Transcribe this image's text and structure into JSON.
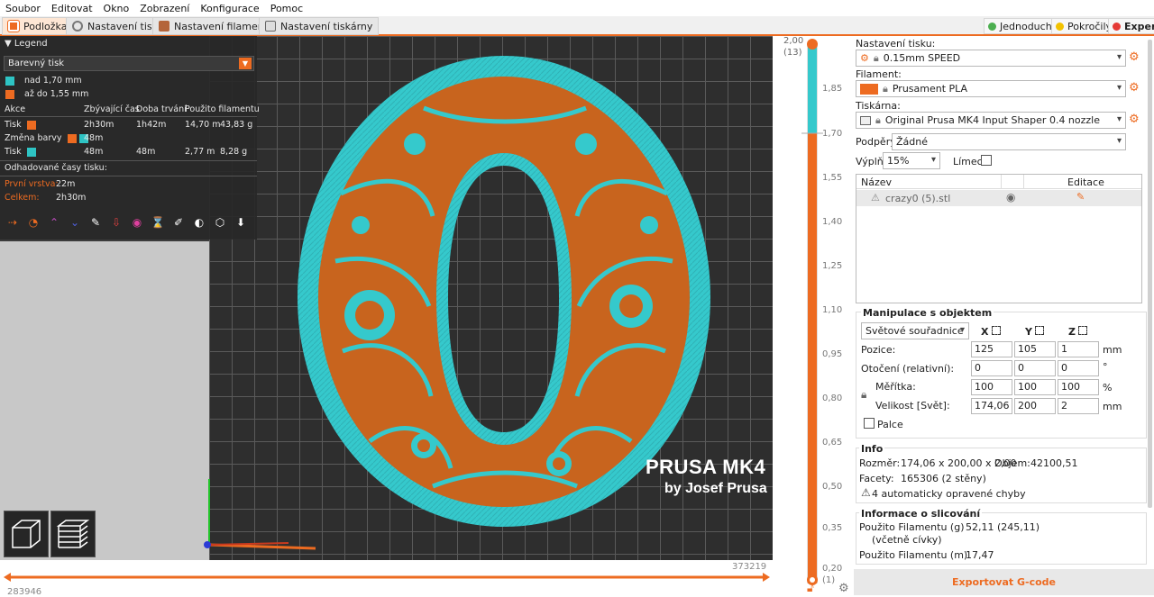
{
  "menu": [
    "Soubor",
    "Editovat",
    "Okno",
    "Zobrazení",
    "Konfigurace",
    "Pomoc"
  ],
  "tabs": [
    {
      "label": "Podložka",
      "icon": "plate-icon"
    },
    {
      "label": "Nastavení tisku",
      "icon": "gear-icon"
    },
    {
      "label": "Nastavení filamentu",
      "icon": "spool-icon"
    },
    {
      "label": "Nastavení tiskárny",
      "icon": "printer-icon"
    }
  ],
  "modes": [
    {
      "label": "Jednoduchý",
      "color": "#4caf50"
    },
    {
      "label": "Pokročilý",
      "color": "#f2c200"
    },
    {
      "label": "Expert",
      "color": "#e53935"
    }
  ],
  "legend": {
    "title": "Legend",
    "view_type": "Barevný tisk",
    "ranges": [
      {
        "label": "nad 1,70 mm",
        "color": "#2ec4c4"
      },
      {
        "label": "až do 1,55 mm",
        "color": "#ed6b21"
      }
    ],
    "columns": [
      "Akce",
      "Zbývající čas",
      "Doba trvání",
      "Použito filamentu"
    ],
    "rows": [
      {
        "action": "Tisk",
        "remaining": "2h30m",
        "duration": "1h42m",
        "length": "14,70 m",
        "weight": "43,83 g"
      },
      {
        "action": "Změna barvy",
        "remaining": "48m",
        "duration": "",
        "length": "",
        "weight": ""
      },
      {
        "action": "Tisk",
        "remaining": "48m",
        "duration": "48m",
        "length": "2,77 m",
        "weight": "8,28 g"
      }
    ],
    "estimated_title": "Odhadované časy tisku:",
    "first_layer_label": "První vrstva:",
    "first_layer_value": "22m",
    "total_label": "Celkem:",
    "total_value": "2h30m"
  },
  "bed_brand": {
    "line1": "PRUSA MK4",
    "line2": "by Josef Prusa"
  },
  "hslider": {
    "left_value": "283946",
    "right_value": "373219"
  },
  "vslider": {
    "top_value": "2,00",
    "top_layer": "(13)",
    "bottom_value": "0,20",
    "bottom_layer": "(1)",
    "ticks": [
      "1,85",
      "1,70",
      "1,55",
      "1,40",
      "1,25",
      "1,10",
      "0,95",
      "0,80",
      "0,65",
      "0,50",
      "0,35"
    ]
  },
  "panel": {
    "print_settings_label": "Nastavení tisku:",
    "print_settings_value": "0.15mm SPEED",
    "filament_label": "Filament:",
    "filament_value": "Prusament PLA",
    "filament_color": "#ed6b21",
    "printer_label": "Tiskárna:",
    "printer_value": "Original Prusa MK4 Input Shaper 0.4 nozzle",
    "supports_label": "Podpěry:",
    "supports_value": "Žádné",
    "infill_label": "Výplň:",
    "infill_value": "15%",
    "brim_label": "Límec:",
    "objects_columns": [
      "Název",
      "Editace"
    ],
    "object_name": "crazy0 (5).stl",
    "manipulation": {
      "title": "Manipulace s objektem",
      "coord_system": "Světové souřadnice",
      "axes": [
        "X",
        "Y",
        "Z"
      ],
      "position_label": "Pozice:",
      "position": [
        "125",
        "105",
        "1"
      ],
      "position_unit": "mm",
      "rotation_label": "Otočení (relativní):",
      "rotation": [
        "0",
        "0",
        "0"
      ],
      "rotation_unit": "°",
      "scale_label": "Měřítka:",
      "scale": [
        "100",
        "100",
        "100"
      ],
      "scale_unit": "%",
      "size_label": "Velikost [Svět]:",
      "size": [
        "174,06",
        "200",
        "2"
      ],
      "size_unit": "mm",
      "inches_label": "Palce"
    },
    "info": {
      "title": "Info",
      "size_label": "Rozměr:",
      "size_value": "174,06 x 200,00 x 2,00",
      "volume_label": "Objem:",
      "volume_value": "42100,51",
      "facets_label": "Facety:",
      "facets_value": "165306 (2 stěny)",
      "errors": "4 automaticky opravené chyby"
    },
    "slice_info": {
      "title": "Informace o slicování",
      "filament_g_label": "Použito Filamentu (g)",
      "filament_g_sub": "(včetně cívky)",
      "filament_g_value": "52,11 (245,11)",
      "filament_m_label": "Použito Filamentu (m)",
      "filament_m_value": "17,47"
    },
    "export_button": "Exportovat G-code"
  }
}
